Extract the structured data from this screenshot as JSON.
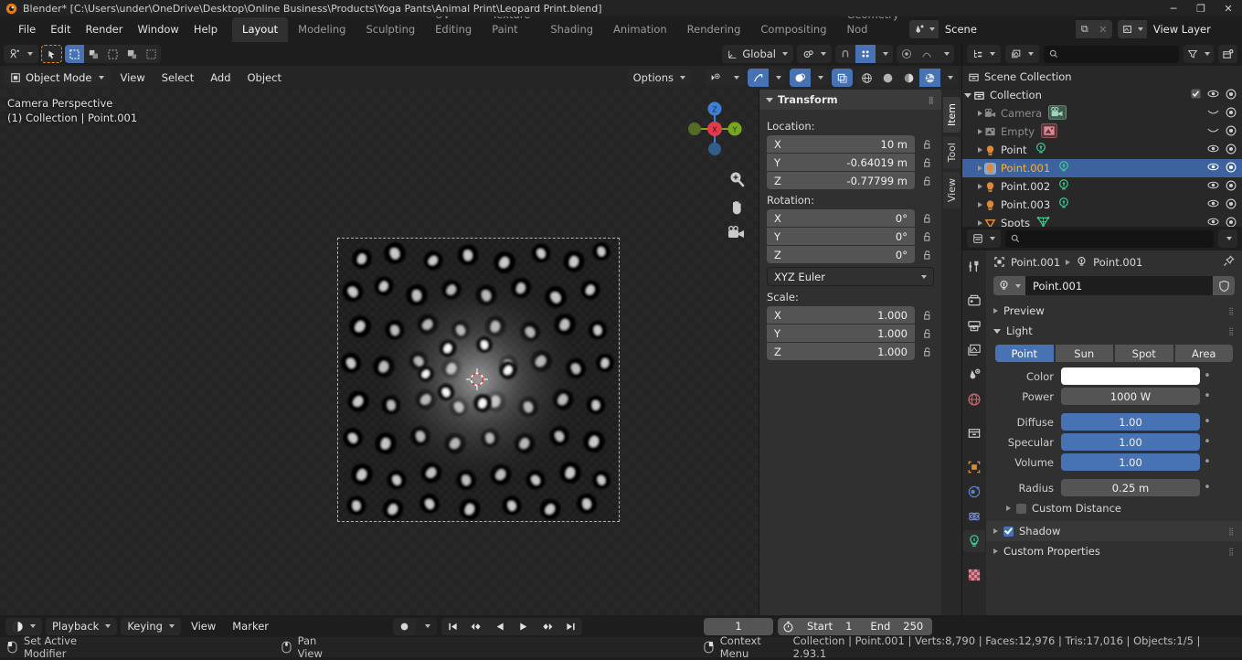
{
  "window": {
    "title": "Blender* [C:\\Users\\under\\OneDrive\\Desktop\\Online Business\\Products\\Yoga Pants\\Animal Print\\Leopard Print.blend]",
    "minimize": "─",
    "maximize": "❐",
    "close": "✕"
  },
  "topbar": {
    "menus": [
      "File",
      "Edit",
      "Render",
      "Window",
      "Help"
    ],
    "workspaces": [
      {
        "label": "Layout",
        "active": true
      },
      {
        "label": "Modeling",
        "active": false
      },
      {
        "label": "Sculpting",
        "active": false
      },
      {
        "label": "UV Editing",
        "active": false
      },
      {
        "label": "Texture Paint",
        "active": false
      },
      {
        "label": "Shading",
        "active": false
      },
      {
        "label": "Animation",
        "active": false
      },
      {
        "label": "Rendering",
        "active": false
      },
      {
        "label": "Compositing",
        "active": false
      },
      {
        "label": "Geometry Nod",
        "active": false
      }
    ],
    "scene_name": "Scene",
    "viewlayer_name": "View Layer",
    "new_label": "⧉",
    "unlink_label": "✕"
  },
  "viewport": {
    "header": {
      "editor_type_icon": "editor-type-icon",
      "mode": "Object Mode",
      "menus": [
        "View",
        "Select",
        "Add",
        "Object"
      ],
      "transform_orientation": "Global",
      "options_label": "Options"
    },
    "overlay_text_line1": "Camera Perspective",
    "overlay_text_line2": "(1) Collection | Point.001",
    "gizmo": {
      "x": "X",
      "y": "Y",
      "z": "Z"
    },
    "sidebar_tabs": [
      {
        "label": "Item",
        "active": true
      },
      {
        "label": "Tool",
        "active": false
      },
      {
        "label": "View",
        "active": false
      }
    ],
    "npanel": {
      "title": "Transform",
      "location_label": "Location:",
      "rotation_label": "Rotation:",
      "scale_label": "Scale:",
      "rotation_mode": "XYZ Euler",
      "location": [
        {
          "axis": "X",
          "value": "10 m"
        },
        {
          "axis": "Y",
          "value": "-0.64019 m"
        },
        {
          "axis": "Z",
          "value": "-0.77799 m"
        }
      ],
      "rotation": [
        {
          "axis": "X",
          "value": "0°"
        },
        {
          "axis": "Y",
          "value": "0°"
        },
        {
          "axis": "Z",
          "value": "0°"
        }
      ],
      "scale": [
        {
          "axis": "X",
          "value": "1.000"
        },
        {
          "axis": "Y",
          "value": "1.000"
        },
        {
          "axis": "Z",
          "value": "1.000"
        }
      ]
    }
  },
  "outliner": {
    "display_mode_icon": "outliner-display-mode-icon",
    "filter_icon": "filter-icon",
    "new_collection_icon": "new-collection-icon",
    "search_placeholder": "",
    "rows": [
      {
        "name": "Scene Collection",
        "indent": 0,
        "icon": "collection-icon",
        "disclosure": "none",
        "dim": false,
        "selected": false,
        "checkbox": false,
        "eye": false,
        "camera": false,
        "datatype": "none"
      },
      {
        "name": "Collection",
        "indent": 1,
        "icon": "collection-icon",
        "disclosure": "down",
        "dim": false,
        "selected": false,
        "checkbox": true,
        "eye": true,
        "camera": true,
        "datatype": "none"
      },
      {
        "name": "Camera",
        "indent": 2,
        "icon": "camera-obj-icon",
        "disclosure": "right",
        "dim": true,
        "selected": false,
        "checkbox": false,
        "eye": "curve",
        "camera": true,
        "datatype": "camera-data-icon"
      },
      {
        "name": "Empty",
        "indent": 2,
        "icon": "empty-image-icon",
        "disclosure": "right",
        "dim": true,
        "selected": false,
        "checkbox": false,
        "eye": "curve",
        "camera": true,
        "datatype": "image-data-icon"
      },
      {
        "name": "Point",
        "indent": 2,
        "icon": "light-obj-icon",
        "disclosure": "right",
        "dim": false,
        "selected": false,
        "checkbox": false,
        "eye": true,
        "camera": true,
        "datatype": "light-data-icon"
      },
      {
        "name": "Point.001",
        "indent": 2,
        "icon": "light-obj-icon",
        "disclosure": "right",
        "dim": false,
        "selected": true,
        "checkbox": false,
        "eye": true,
        "camera": true,
        "datatype": "light-data-icon"
      },
      {
        "name": "Point.002",
        "indent": 2,
        "icon": "light-obj-icon",
        "disclosure": "right",
        "dim": false,
        "selected": false,
        "checkbox": false,
        "eye": true,
        "camera": true,
        "datatype": "light-data-icon"
      },
      {
        "name": "Point.003",
        "indent": 2,
        "icon": "light-obj-icon",
        "disclosure": "right",
        "dim": false,
        "selected": false,
        "checkbox": false,
        "eye": true,
        "camera": true,
        "datatype": "light-data-icon"
      },
      {
        "name": "Spots",
        "indent": 2,
        "icon": "mesh-obj-icon",
        "disclosure": "right",
        "dim": false,
        "selected": false,
        "checkbox": false,
        "eye": true,
        "camera": true,
        "datatype": "mesh-data-icon"
      }
    ]
  },
  "properties": {
    "search_placeholder": "",
    "breadcrumb_object": "Point.001",
    "breadcrumb_data": "Point.001",
    "id_name": "Point.001",
    "panels": {
      "preview": "Preview",
      "light": "Light",
      "shadow": "Shadow",
      "custom_properties": "Custom Properties",
      "custom_distance": "Custom Distance"
    },
    "light_types": [
      {
        "label": "Point",
        "active": true
      },
      {
        "label": "Sun",
        "active": false
      },
      {
        "label": "Spot",
        "active": false
      },
      {
        "label": "Area",
        "active": false
      }
    ],
    "fields": [
      {
        "label": "Color",
        "value": "",
        "style": "white"
      },
      {
        "label": "Power",
        "value": "1000 W",
        "style": "grey"
      },
      {
        "label": "Diffuse",
        "value": "1.00",
        "style": "blue"
      },
      {
        "label": "Specular",
        "value": "1.00",
        "style": "blue"
      },
      {
        "label": "Volume",
        "value": "1.00",
        "style": "blue"
      },
      {
        "label": "Radius",
        "value": "0.25 m",
        "style": "grey"
      }
    ],
    "tabs": [
      "tool-icon",
      "render-icon",
      "output-icon",
      "viewlayer-icon",
      "scene-icon",
      "world-icon",
      "collection-icon",
      "object-icon",
      "modifier-icon",
      "physics-icon",
      "light-data-icon",
      "texture-icon"
    ]
  },
  "timeline": {
    "editor_icon": "timeline-editor-icon",
    "playback_label": "Playback",
    "keying_label": "Keying",
    "view_label": "View",
    "marker_label": "Marker",
    "record_icon": "record-icon",
    "transport": [
      "jump-start-icon",
      "prev-keyframe-icon",
      "play-reverse-icon",
      "play-icon",
      "next-keyframe-icon",
      "jump-end-icon"
    ],
    "current_frame": "1",
    "use_preview_range_icon": "stopwatch-icon",
    "start_label": "Start",
    "start_value": "1",
    "end_label": "End",
    "end_value": "250"
  },
  "statusbar": {
    "keymap": [
      {
        "icon": "mouse-left-icon",
        "label": "Set Active Modifier"
      },
      {
        "icon": "mouse-middle-icon",
        "label": "Pan View"
      },
      {
        "icon": "mouse-right-icon",
        "label": "Context Menu"
      }
    ],
    "scene_stats": "Collection | Point.001 | Verts:8,790 | Faces:12,976 | Tris:17,016 | Objects:1/5 | 2.93.1"
  },
  "colors": {
    "accent_blue": "#4772b3",
    "selection_orange": "#ffaf29",
    "bg_dark": "#1d1d1d",
    "panel_bg": "#303030",
    "field_bg": "#545454"
  }
}
